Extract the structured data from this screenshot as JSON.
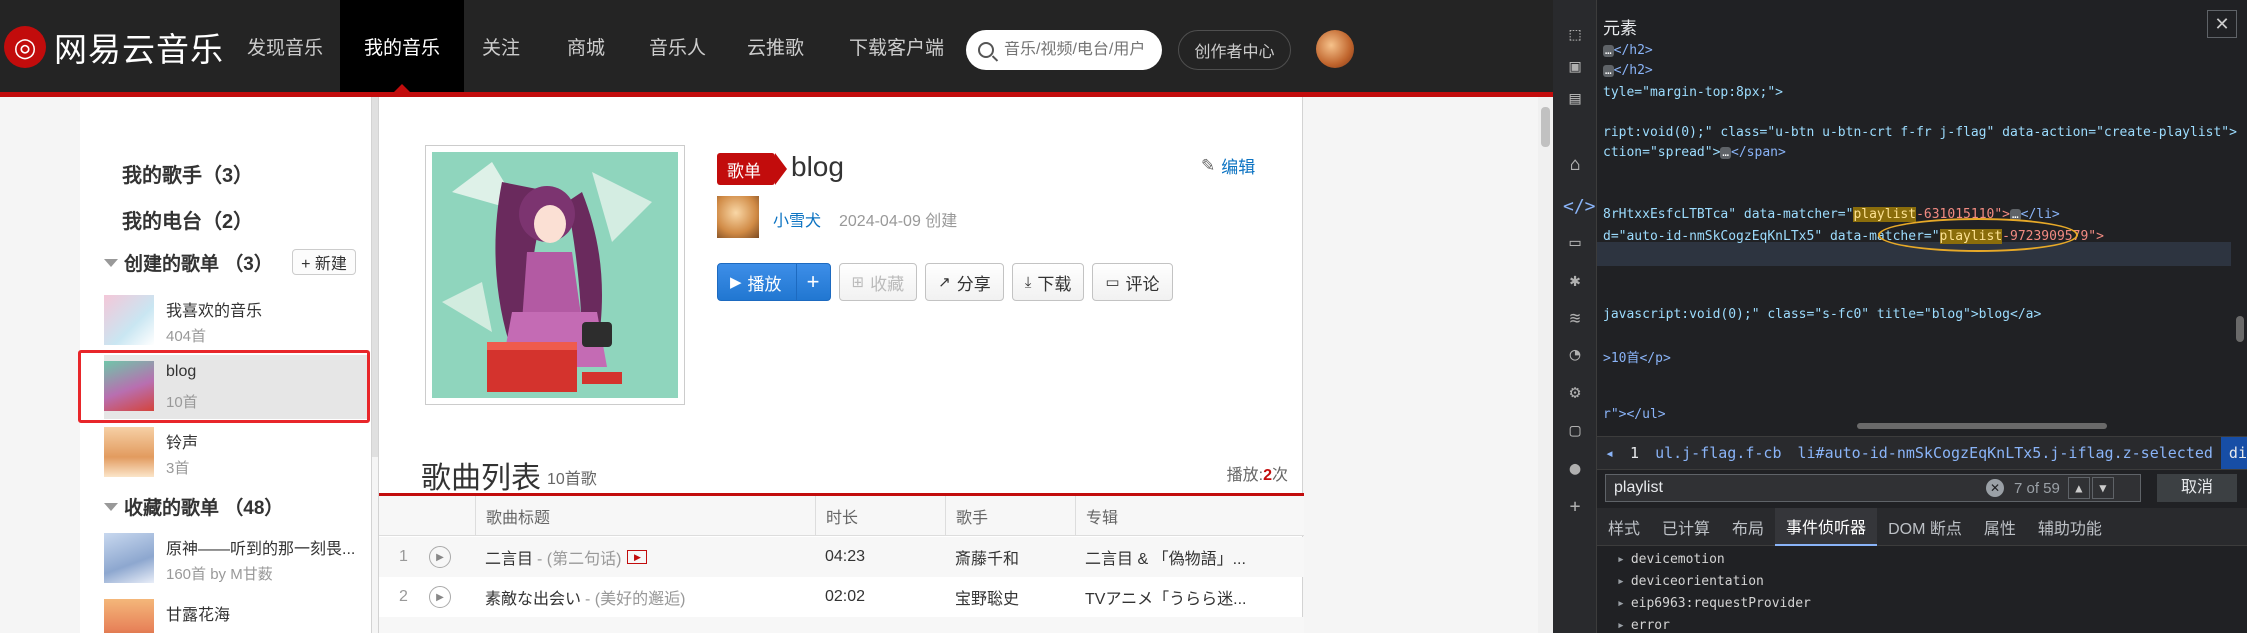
{
  "site": {
    "logo_text": "网易云音乐",
    "nav": [
      "发现音乐",
      "我的音乐",
      "关注",
      "商城",
      "音乐人",
      "云推歌",
      "下载客户端"
    ],
    "search_placeholder": "音乐/视频/电台/用户",
    "creator_center": "创作者中心"
  },
  "sidebar": {
    "my_singers": "我的歌手（3）",
    "my_radios": "我的电台（2）",
    "created_section": "创建的歌单 （3）",
    "new_button": "+ 新建",
    "created": [
      {
        "name": "我喜欢的音乐",
        "count": "404首"
      },
      {
        "name": "blog",
        "count": "10首"
      },
      {
        "name": "铃声",
        "count": "3首"
      }
    ],
    "collected_section": "收藏的歌单 （48）",
    "collected": [
      {
        "name": "原神——听到的那一刻畏...",
        "count": "160首 by M甘薮"
      },
      {
        "name": "甘露花海",
        "count": ""
      }
    ]
  },
  "playlist": {
    "tag": "歌单",
    "title": "blog",
    "edit": "编辑",
    "creator": "小雪犬",
    "created_date": "2024-04-09 创建",
    "buttons": {
      "play": "播放",
      "plus": "+",
      "collect": "收藏",
      "share": "分享",
      "download": "下载",
      "comment": "评论"
    },
    "list_title": "歌曲列表",
    "list_count": "10首歌",
    "play_label": "播放:",
    "play_count": "2",
    "play_unit": "次",
    "columns": [
      "歌曲标题",
      "时长",
      "歌手",
      "专辑"
    ],
    "songs": [
      {
        "no": "1",
        "title": "二言目",
        "sub": "- (第二句话)",
        "duration": "04:23",
        "artist": "斎藤千和",
        "album": "二言目 & 「偽物語」..."
      },
      {
        "no": "2",
        "title": "素敵な出会い",
        "sub": "- (美好的邂逅)",
        "duration": "02:02",
        "artist": "宝野聡史",
        "album": "TVアニメ「うらら迷..."
      }
    ]
  },
  "devtools": {
    "title": "元素",
    "close": "✕",
    "code": {
      "l1": "</h2>",
      "l2": "</h2>",
      "l3": "tyle=\"margin-top:8px;\">",
      "l4a": "ript:void(0);\" class=\"u-btn u-btn-crt f-fr j-flag\" data-action=\"create-playlist\">",
      "l5": "ction=\"spread\">",
      "l5b": "</span>",
      "l6a": "8rHtxxEsfcLTBTca\" data-matcher=\"",
      "l6hl": "playlist",
      "l6b": "-631015110\">",
      "l6c": "</li>",
      "l7a": "d=\"auto-id-nmSkCogzEqKnLTx5\" data-matcher=\"",
      "l7hl": "playlist",
      "l7b": "-9723909579\">",
      "l8": "javascript:void(0);\" class=\"s-fc0\" title=\"blog\">blog</a>",
      "l9": ">10首</p>",
      "l10": "r\"></ul>"
    },
    "crumbs": [
      "◂",
      "1",
      "ul.j-flag.f-cb",
      "li#auto-id-nmSkCogzEqKnLTx5.j-iflag.z-selected",
      "div.item.f-cb",
      "▸"
    ],
    "find": {
      "value": "playlist",
      "count": "7 of 59",
      "cancel": "取消"
    },
    "subtabs": [
      "样式",
      "已计算",
      "布局",
      "事件侦听器",
      "DOM 断点",
      "属性",
      "辅助功能"
    ],
    "listeners": [
      "devicemotion",
      "deviceorientation",
      "eip6963:requestProvider",
      "error"
    ]
  }
}
